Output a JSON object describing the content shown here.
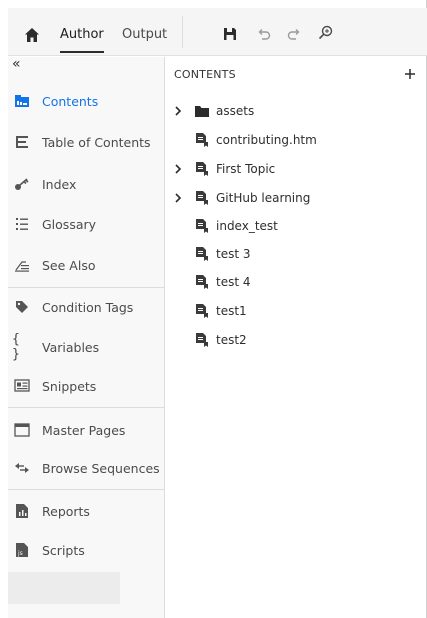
{
  "toolbar": {
    "tabs": [
      {
        "label": "Author",
        "active": true
      },
      {
        "label": "Output",
        "active": false
      }
    ],
    "icons": [
      "home-icon",
      "save-icon",
      "undo-icon",
      "redo-icon",
      "find-replace-icon"
    ]
  },
  "sidebar": {
    "collapse_label": "«",
    "items": [
      {
        "label": "Contents",
        "icon": "contents-icon",
        "active": true
      },
      {
        "label": "Table of Contents",
        "icon": "toc-icon",
        "active": false
      },
      {
        "label": "Index",
        "icon": "key-icon",
        "active": false
      },
      {
        "label": "Glossary",
        "icon": "glossary-icon",
        "active": false
      },
      {
        "label": "See Also",
        "icon": "see-also-icon",
        "active": false
      },
      {
        "label": "Condition Tags",
        "icon": "tag-icon",
        "active": false
      },
      {
        "label": "Variables",
        "icon": "braces-icon",
        "active": false
      },
      {
        "label": "Snippets",
        "icon": "snippet-icon",
        "active": false
      },
      {
        "label": "Master Pages",
        "icon": "master-page-icon",
        "active": false
      },
      {
        "label": "Browse Sequences",
        "icon": "browse-sequence-icon",
        "active": false
      },
      {
        "label": "Reports",
        "icon": "reports-icon",
        "active": false
      },
      {
        "label": "Scripts",
        "icon": "scripts-icon",
        "active": false
      }
    ]
  },
  "panel": {
    "title": "CONTENTS",
    "add_label": "+",
    "tree": [
      {
        "label": "assets",
        "type": "folder",
        "expandable": true
      },
      {
        "label": "contributing.htm",
        "type": "file",
        "expandable": false
      },
      {
        "label": "First Topic",
        "type": "file",
        "expandable": true
      },
      {
        "label": "GitHub learning",
        "type": "file",
        "expandable": true
      },
      {
        "label": "index_test",
        "type": "file",
        "expandable": false
      },
      {
        "label": "test 3",
        "type": "file",
        "expandable": false
      },
      {
        "label": "test 4",
        "type": "file",
        "expandable": false
      },
      {
        "label": "test1",
        "type": "file",
        "expandable": false
      },
      {
        "label": "test2",
        "type": "file",
        "expandable": false
      }
    ]
  },
  "colors": {
    "accent": "#1473e6",
    "toolbar_bg": "#f5f5f5",
    "sidebar_bg": "#f8f8f8",
    "text": "#4b4b4b"
  }
}
